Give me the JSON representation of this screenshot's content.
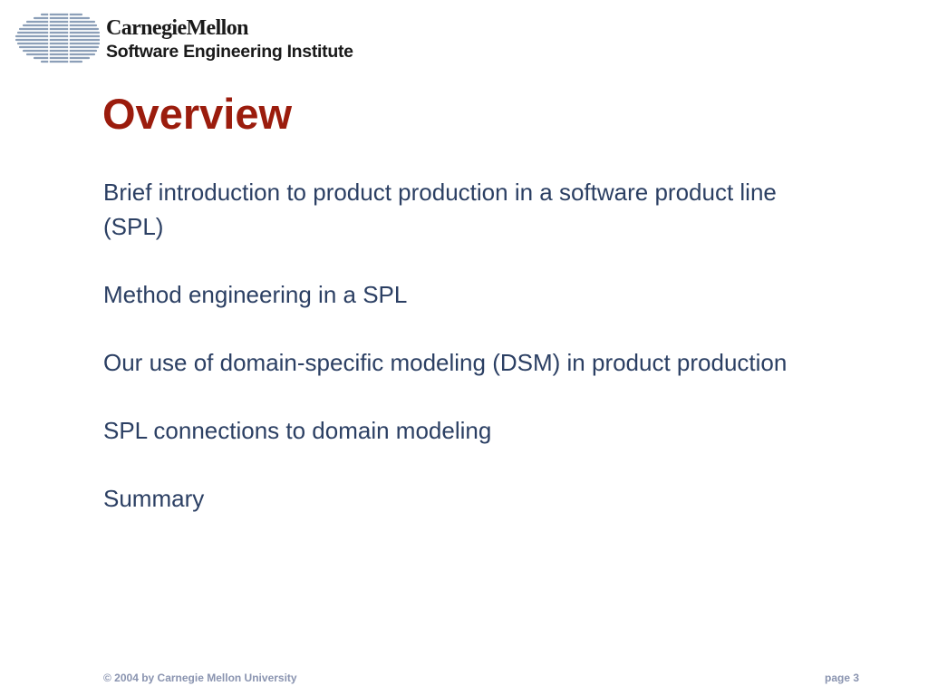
{
  "header": {
    "org_name": "CarnegieMellon",
    "org_unit": "Software Engineering Institute",
    "logo_icon": "sei-striped-globe-icon"
  },
  "slide": {
    "title": "Overview",
    "bullets": [
      "Brief introduction to product production in a software product line (SPL)",
      "Method engineering in a SPL",
      "Our use of domain-specific modeling (DSM) in product production",
      "SPL connections to domain modeling",
      "Summary"
    ]
  },
  "footer": {
    "copyright": "© 2004 by Carnegie Mellon University",
    "page_label": "page 3"
  },
  "colors": {
    "title": "#9b1c0d",
    "body_text": "#2b3f63",
    "footer_text": "#8a94b0",
    "logo_stripes": "#8c9fb8"
  }
}
